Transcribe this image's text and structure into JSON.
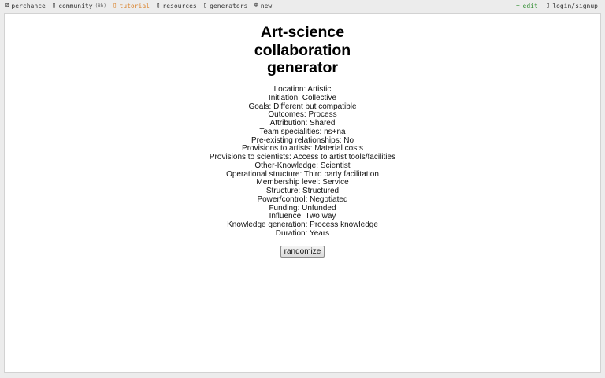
{
  "topbar": {
    "left": [
      {
        "icon": "dice-icon",
        "glyph": "⚄",
        "label": "perchance"
      },
      {
        "icon": "community-icon",
        "glyph": "▯",
        "label": "community",
        "badge": "(8h)"
      },
      {
        "icon": "tutorial-icon",
        "glyph": "▯",
        "label": "tutorial"
      },
      {
        "icon": "resources-icon",
        "glyph": "▯",
        "label": "resources"
      },
      {
        "icon": "generators-icon",
        "glyph": "▯",
        "label": "generators"
      },
      {
        "icon": "plus-circle-icon",
        "glyph": "⊕",
        "label": "new"
      }
    ],
    "right": [
      {
        "icon": "pencil-icon",
        "glyph": "✏",
        "label": "edit"
      },
      {
        "icon": "user-icon",
        "glyph": "▯",
        "label": "login/signup"
      }
    ]
  },
  "title_lines": [
    "Art-science",
    "collaboration",
    "generator"
  ],
  "results": [
    "Location: Artistic",
    "Initiation: Collective",
    "Goals: Different but compatible",
    "Outcomes: Process",
    "Attribution: Shared",
    "Team specialities: ns+na",
    "Pre-existing relationships: No",
    "Provisions to artists: Material costs",
    "Provisions to scientists: Access to artist tools/facilities",
    "Other-Knowledge: Scientist",
    "Operational structure: Third party facilitation",
    "Membership level: Service",
    "Structure: Structured",
    "Power/control: Negotiated",
    "Funding: Unfunded",
    "Influence: Two way",
    "Knowledge generation: Process knowledge",
    "Duration: Years"
  ],
  "randomize_label": "randomize",
  "colors": {
    "tutorial": "#d9822b",
    "edit": "#2e8b2e",
    "background": "#ececec"
  }
}
